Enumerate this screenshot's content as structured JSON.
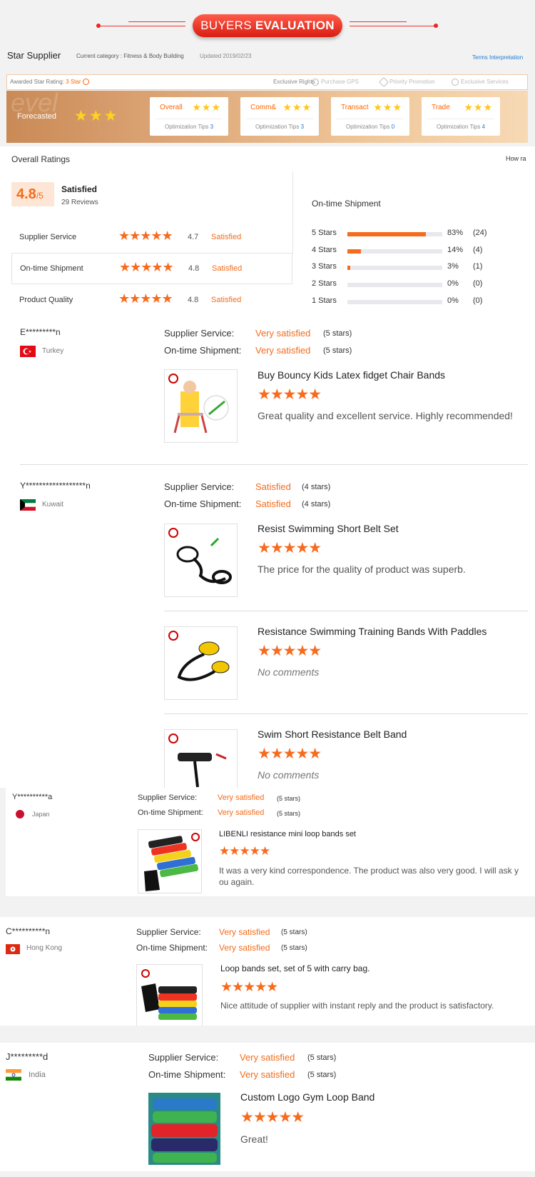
{
  "banner": {
    "word1": "BUYERS",
    "word2": "EVALUATION"
  },
  "supplier": {
    "title": "Star Supplier",
    "category": "Current category : Fitness & Body Building",
    "updated": "Updated 2019/02/23",
    "terms": "Terms Interpretation",
    "awarded_label": "Awarded Star Rating:",
    "awarded_value": "3 Star",
    "exclusive_label": "Exclusive Rights :",
    "exclusive_items": [
      "Purchase GPS",
      "Priority Promotion",
      "Exclusive Services"
    ],
    "band_bg_text": "evel",
    "forecasted": "Forecasted",
    "forecast_stars": "★★★",
    "cards": [
      {
        "name": "Overall",
        "stars": "★★★",
        "tips": "Optimization Tips",
        "count": "3"
      },
      {
        "name": "Comm&",
        "stars": "★★★",
        "tips": "Optimization Tips",
        "count": "3"
      },
      {
        "name": "Transact",
        "stars": "★★★",
        "tips": "Optimization Tips",
        "count": "0"
      },
      {
        "name": "Trade",
        "stars": "★★★",
        "tips": "Optimization Tips",
        "count": "4"
      }
    ]
  },
  "overall": {
    "title": "Overall Ratings",
    "how": "How ra",
    "score": "4.8",
    "out_of": "/5",
    "word": "Satisfied",
    "reviews": "29 Reviews",
    "dimensions": [
      {
        "label": "Supplier Service",
        "stars": "★★★★★",
        "score": "4.7",
        "word": "Satisfied"
      },
      {
        "label": "On-time Shipment",
        "stars": "★★★★★",
        "score": "4.8",
        "word": "Satisfied"
      },
      {
        "label": "Product Quality",
        "stars": "★★★★★",
        "score": "4.8",
        "word": "Satisfied"
      }
    ],
    "shipment_title": "On-time Shipment",
    "breakdown": [
      {
        "label": "5 Stars",
        "pct": "83%",
        "count": "(24)",
        "fill": 0.83
      },
      {
        "label": "4 Stars",
        "pct": "14%",
        "count": "(4)",
        "fill": 0.14
      },
      {
        "label": "3 Stars",
        "pct": "3%",
        "count": "(1)",
        "fill": 0.03
      },
      {
        "label": "2 Stars",
        "pct": "0%",
        "count": "(0)",
        "fill": 0
      },
      {
        "label": "1 Stars",
        "pct": "0%",
        "count": "(0)",
        "fill": 0
      }
    ]
  },
  "labels": {
    "supplier_service": "Supplier Service:",
    "ontime": "On-time Shipment:",
    "no_comments": "No comments",
    "five_stars": "★★★★★"
  },
  "reviews": [
    {
      "name": "E*********n",
      "country": "Turkey",
      "service": "Very satisfied",
      "service_stars": "(5 stars)",
      "shipment": "Very satisfied",
      "shipment_stars": "(5 stars)",
      "products": [
        {
          "title": "Buy Bouncy Kids Latex fidget Chair Bands",
          "comment": "Great quality and excellent service. Highly recommended!"
        }
      ]
    },
    {
      "name": "Y******************n",
      "country": "Kuwait",
      "service": "Satisfied",
      "service_stars": "(4 stars)",
      "shipment": "Satisfied",
      "shipment_stars": "(4 stars)",
      "products": [
        {
          "title": "Resist Swimming Short Belt Set",
          "comment": "The price for the quality of product was superb."
        },
        {
          "title": "Resistance Swimming Training Bands With Paddles",
          "comment": "No comments"
        },
        {
          "title": "Swim Short Resistance Belt Band",
          "comment": "No comments"
        }
      ]
    },
    {
      "name": "Y**********a",
      "country": "Japan",
      "service": "Very satisfied",
      "service_stars": "(5 stars)",
      "shipment": "Very satisfied",
      "shipment_stars": "(5 stars)",
      "products": [
        {
          "title": "LIBENLI resistance mini loop bands set",
          "comment": "It was a very kind correspondence. The product was also very good. I will ask y",
          "comment2": "ou again."
        }
      ]
    },
    {
      "name": "C**********n",
      "country": "Hong Kong",
      "service": "Very satisfied",
      "service_stars": "(5 stars)",
      "shipment": "Very satisfied",
      "shipment_stars": "(5 stars)",
      "products": [
        {
          "title": "Loop bands set, set of 5 with carry bag.",
          "comment": "Nice attitude of supplier with instant reply and the product is satisfactory."
        }
      ]
    },
    {
      "name": "J*********d",
      "country": "India",
      "service": "Very satisfied",
      "service_stars": "(5 stars)",
      "shipment": "Very satisfied",
      "shipment_stars": "(5 stars)",
      "products": [
        {
          "title": "Custom Logo Gym Loop Band",
          "comment": "Great!"
        }
      ]
    }
  ],
  "colors": {
    "accent": "#f36c1b",
    "star_orange": "#f66b1e",
    "star_gold": "#ffc61a",
    "link": "#1a7ad4"
  }
}
